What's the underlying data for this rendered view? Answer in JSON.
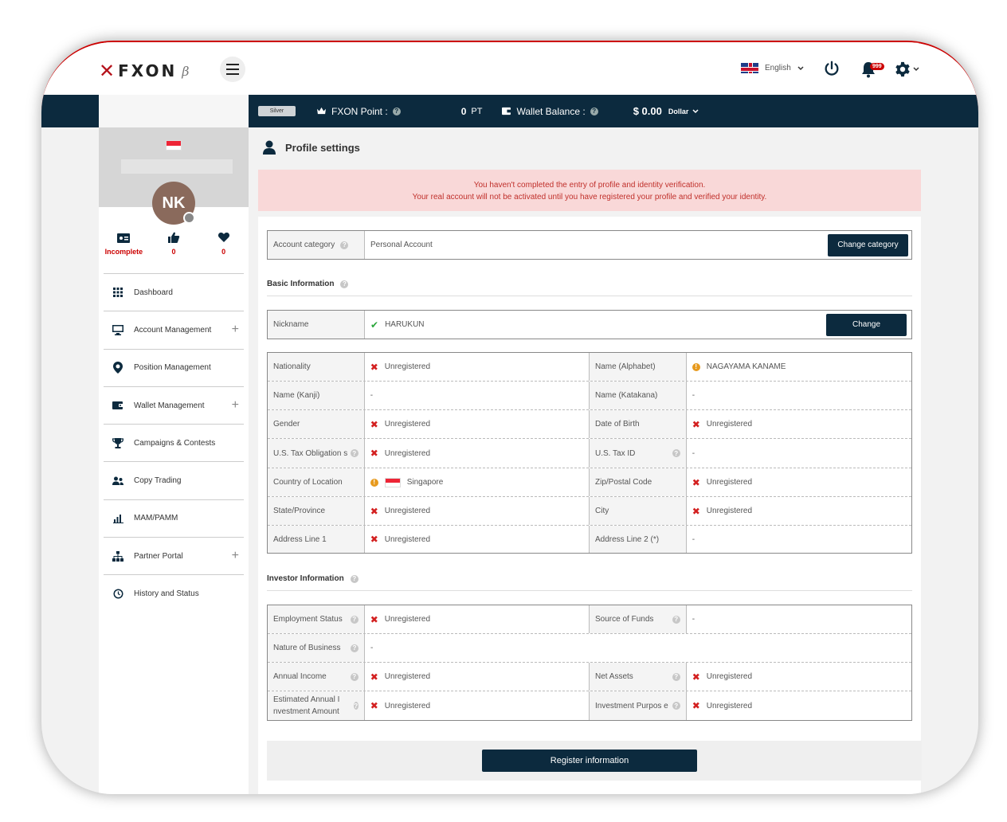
{
  "header": {
    "logo_text": "FXON",
    "logo_beta": "β",
    "language": "English",
    "notification_count": "999"
  },
  "statusbar": {
    "tier": "Silver",
    "fxon_point_label": "FXON Point :",
    "fxon_point_value": "0",
    "fxon_point_unit": "PT",
    "wallet_label": "Wallet Balance :",
    "wallet_value": "$ 0.00",
    "wallet_currency": "Dollar"
  },
  "profile": {
    "initials": "NK",
    "stats": [
      {
        "label": "Incomplete",
        "icon": "id-card-icon"
      },
      {
        "label": "0",
        "icon": "thumbs-up-icon"
      },
      {
        "label": "0",
        "icon": "heart-icon"
      }
    ]
  },
  "nav": [
    {
      "label": "Dashboard",
      "icon": "grid-icon",
      "expandable": false
    },
    {
      "label": "Account Management",
      "icon": "monitor-icon",
      "expandable": true
    },
    {
      "label": "Position Management",
      "icon": "map-pin-icon",
      "expandable": false
    },
    {
      "label": "Wallet Management",
      "icon": "wallet-icon",
      "expandable": true
    },
    {
      "label": "Campaigns & Contests",
      "icon": "trophy-icon",
      "expandable": false
    },
    {
      "label": "Copy Trading",
      "icon": "users-icon",
      "expandable": false
    },
    {
      "label": "MAM/PAMM",
      "icon": "bar-chart-icon",
      "expandable": false
    },
    {
      "label": "Partner Portal",
      "icon": "org-chart-icon",
      "expandable": true
    },
    {
      "label": "History and Status",
      "icon": "clock-icon",
      "expandable": false
    }
  ],
  "page": {
    "title": "Profile settings",
    "alert_line1": "You haven't completed the entry of profile and identity verification.",
    "alert_line2": "Your real account will not be activated until you have registered your profile and verified your identity.",
    "account_category_label": "Account category",
    "account_category_value": "Personal Account",
    "change_category_button": "Change category",
    "basic_info_title": "Basic Information",
    "nickname_label": "Nickname",
    "nickname_value": "HARUKUN",
    "change_button": "Change",
    "investor_info_title": "Investor Information",
    "register_button": "Register information"
  },
  "basic_rows": [
    [
      {
        "label": "Nationality",
        "status": "x",
        "value": "Unregistered"
      },
      {
        "label": "Name (Alphabet)",
        "status": "warn",
        "value": "NAGAYAMA KANAME"
      }
    ],
    [
      {
        "label": "Name (Kanji)",
        "status": "none",
        "value": "-"
      },
      {
        "label": "Name (Katakana)",
        "status": "none",
        "value": "-"
      }
    ],
    [
      {
        "label": "Gender",
        "status": "x",
        "value": "Unregistered"
      },
      {
        "label": "Date of Birth",
        "status": "x",
        "value": "Unregistered"
      }
    ],
    [
      {
        "label": "U.S. Tax Obligation s",
        "help": true,
        "status": "x",
        "value": "Unregistered"
      },
      {
        "label": "U.S. Tax ID",
        "help": true,
        "status": "none",
        "value": "-"
      }
    ],
    [
      {
        "label": "Country of Location",
        "status": "warn",
        "flag": true,
        "value": "Singapore"
      },
      {
        "label": "Zip/Postal Code",
        "status": "x",
        "value": "Unregistered"
      }
    ],
    [
      {
        "label": "State/Province",
        "status": "x",
        "value": "Unregistered"
      },
      {
        "label": "City",
        "status": "x",
        "value": "Unregistered"
      }
    ],
    [
      {
        "label": "Address Line 1",
        "status": "x",
        "value": "Unregistered"
      },
      {
        "label": "Address Line 2 (*)",
        "status": "none",
        "value": "-"
      }
    ]
  ],
  "investor_rows": [
    [
      {
        "label": "Employment Status",
        "help": true,
        "status": "x",
        "value": "Unregistered"
      },
      {
        "label": "Source of Funds",
        "help": true,
        "status": "none",
        "value": "-"
      }
    ],
    [
      {
        "label": "Nature of Business",
        "help": true,
        "status": "none",
        "value": "-",
        "wide": true
      }
    ],
    [
      {
        "label": "Annual Income",
        "help": true,
        "status": "x",
        "value": "Unregistered"
      },
      {
        "label": "Net Assets",
        "help": true,
        "status": "x",
        "value": "Unregistered"
      }
    ],
    [
      {
        "label": "Estimated Annual I nvestment Amount",
        "help": true,
        "status": "x",
        "value": "Unregistered"
      },
      {
        "label": "Investment Purpos e",
        "help": true,
        "status": "x",
        "value": "Unregistered"
      }
    ]
  ]
}
